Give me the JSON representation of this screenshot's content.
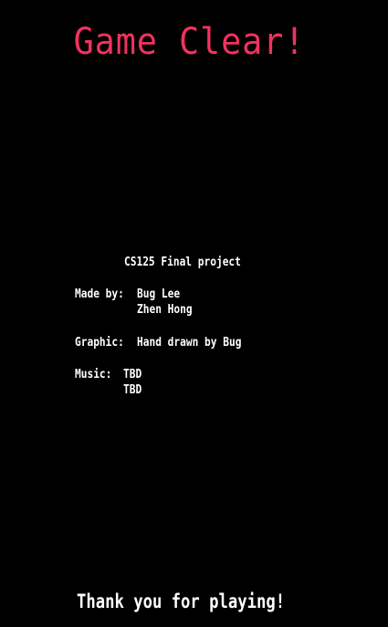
{
  "colors": {
    "background": "#000000",
    "title": "#f0335e",
    "text": "#ffffff"
  },
  "title": "Game Clear!",
  "credits": {
    "project": "CS125 Final project",
    "made_by_label": "Made by:",
    "made_by": [
      "Bug Lee",
      "Zhen Hong"
    ],
    "graphic_label": "Graphic:",
    "graphic": "Hand drawn by Bug",
    "music_label": "Music:",
    "music": [
      "TBD",
      "TBD"
    ]
  },
  "thanks": "Thank you for playing!"
}
